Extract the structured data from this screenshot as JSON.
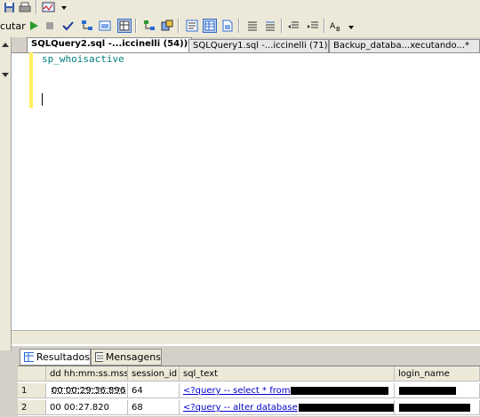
{
  "toolbar": {
    "execute_label": "cutar"
  },
  "tabs": [
    {
      "label": "SQLQuery2.sql -...iccinelli (54))*"
    },
    {
      "label": "SQLQuery1.sql -...iccinelli (71))*"
    },
    {
      "label": "Backup_databa...xecutando...*"
    }
  ],
  "editor": {
    "code": "sp_whoisactive"
  },
  "results": {
    "tab_results": "Resultados",
    "tab_messages": "Mensagens",
    "columns": [
      "dd hh:mm:ss.mss",
      "session_id",
      "sql_text",
      "login_name"
    ],
    "rows": [
      {
        "num": "1",
        "time": "00 00:29:36.896",
        "session_id": "64",
        "sql_text": "<?query -- select * from"
      },
      {
        "num": "2",
        "time": "00 00:27.820",
        "session_id": "68",
        "sql_text": "<?query -- alter database"
      }
    ]
  },
  "colors": {
    "chrome": "#ece9d8",
    "code": "#008080",
    "gutter": "#ffee62",
    "link": "#0000cc"
  }
}
